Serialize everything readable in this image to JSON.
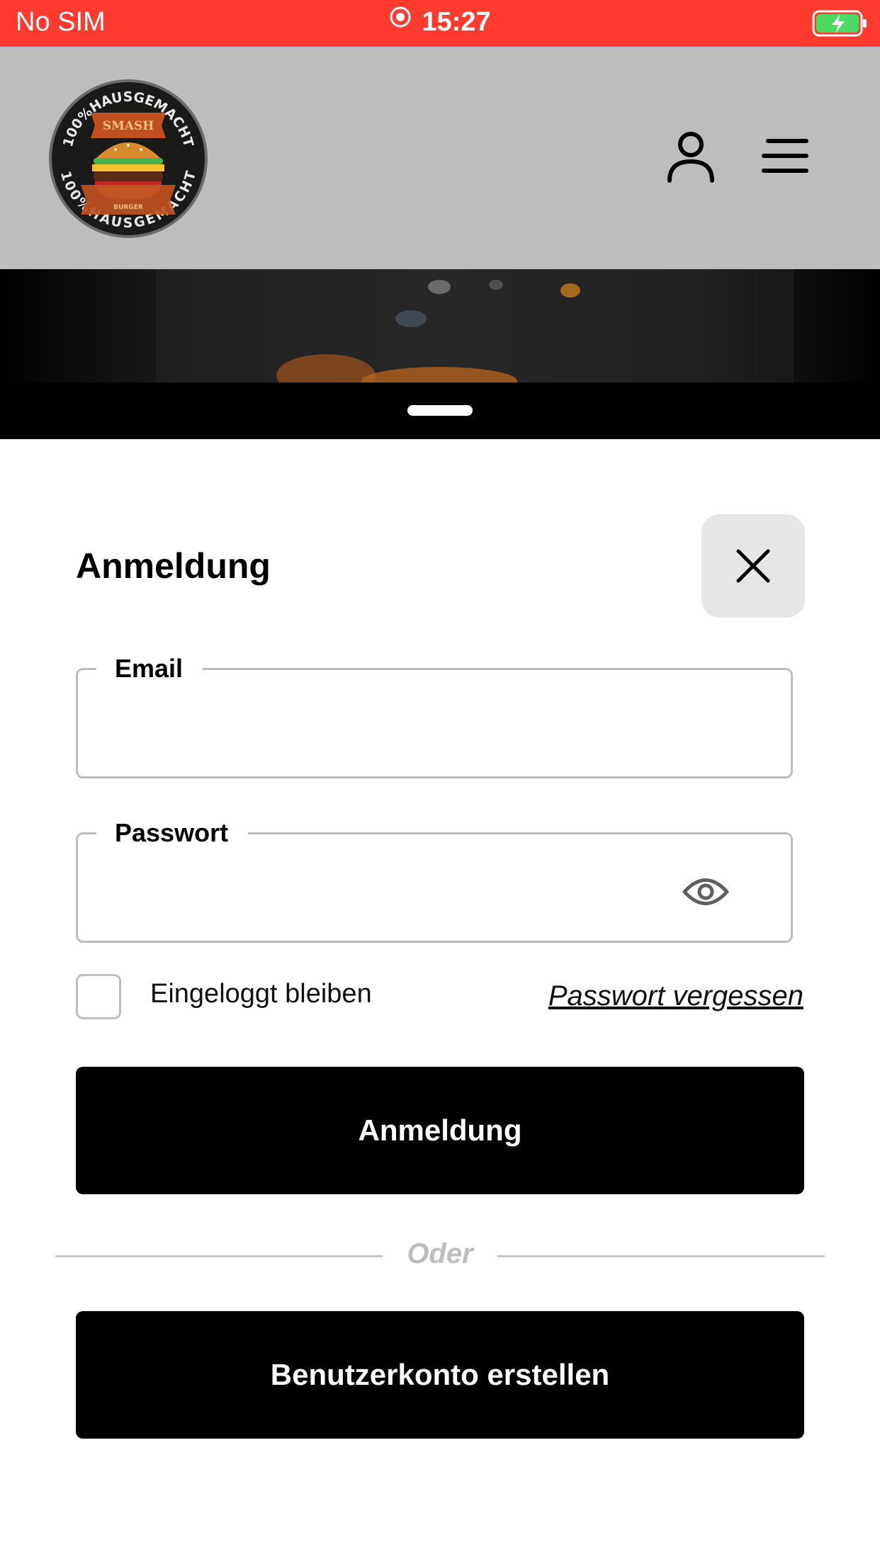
{
  "status_bar": {
    "carrier": "No SIM",
    "time": "15:27"
  },
  "header": {
    "logo": {
      "top_text": "100%HAUSGEMACHT",
      "banner_text": "SMASH",
      "bottom_small": "BURGER",
      "bottom_text": "100%HAUSGEMACHT"
    }
  },
  "login": {
    "title": "Anmeldung",
    "email_label": "Email",
    "email_value": "",
    "password_label": "Passwort",
    "password_value": "",
    "remember_label": "Eingeloggt bleiben",
    "remember_checked": false,
    "forgot_label": "Passwort vergessen",
    "login_button": "Anmeldung",
    "divider": "Oder",
    "register_button": "Benutzerkonto erstellen"
  },
  "colors": {
    "status_bar": "#ff3b30",
    "header_bg": "#bdbdbd",
    "button_bg": "#000000",
    "close_bg": "#e6e6e6",
    "battery_fill": "#4cd964"
  },
  "icons": [
    "record-icon",
    "battery-charging-icon",
    "account-icon",
    "menu-icon",
    "close-icon",
    "eye-icon"
  ]
}
